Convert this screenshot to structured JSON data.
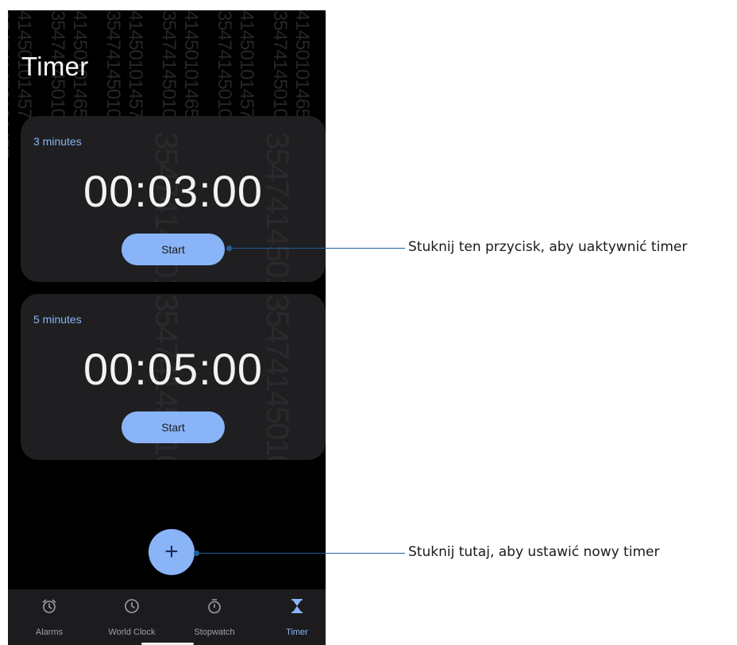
{
  "screen": {
    "title": "Timer",
    "watermark_top": "41450101457",
    "watermark_top_alt": "41450101465",
    "watermark_bottom": "354741450101457",
    "watermark_bottom_alt": "354741450101465"
  },
  "timers": [
    {
      "label": "3 minutes",
      "time": "00:03:00",
      "button": "Start"
    },
    {
      "label": "5 minutes",
      "time": "00:05:00",
      "button": "Start"
    }
  ],
  "fab": {
    "icon": "plus-icon",
    "symbol": "+"
  },
  "nav": [
    {
      "label": "Alarms",
      "icon": "alarm-icon",
      "active": false
    },
    {
      "label": "World Clock",
      "icon": "clock-icon",
      "active": false
    },
    {
      "label": "Stopwatch",
      "icon": "stopwatch-icon",
      "active": false
    },
    {
      "label": "Timer",
      "icon": "hourglass-icon",
      "active": true
    }
  ],
  "callouts": {
    "start": "Stuknij ten przycisk, aby uaktywnić timer",
    "add": "Stuknij tutaj, aby ustawić nowy timer"
  },
  "colors": {
    "accent": "#8ab4f8",
    "background": "#000000",
    "card": "#1f1f21",
    "callout_line": "#1f5f9a"
  }
}
